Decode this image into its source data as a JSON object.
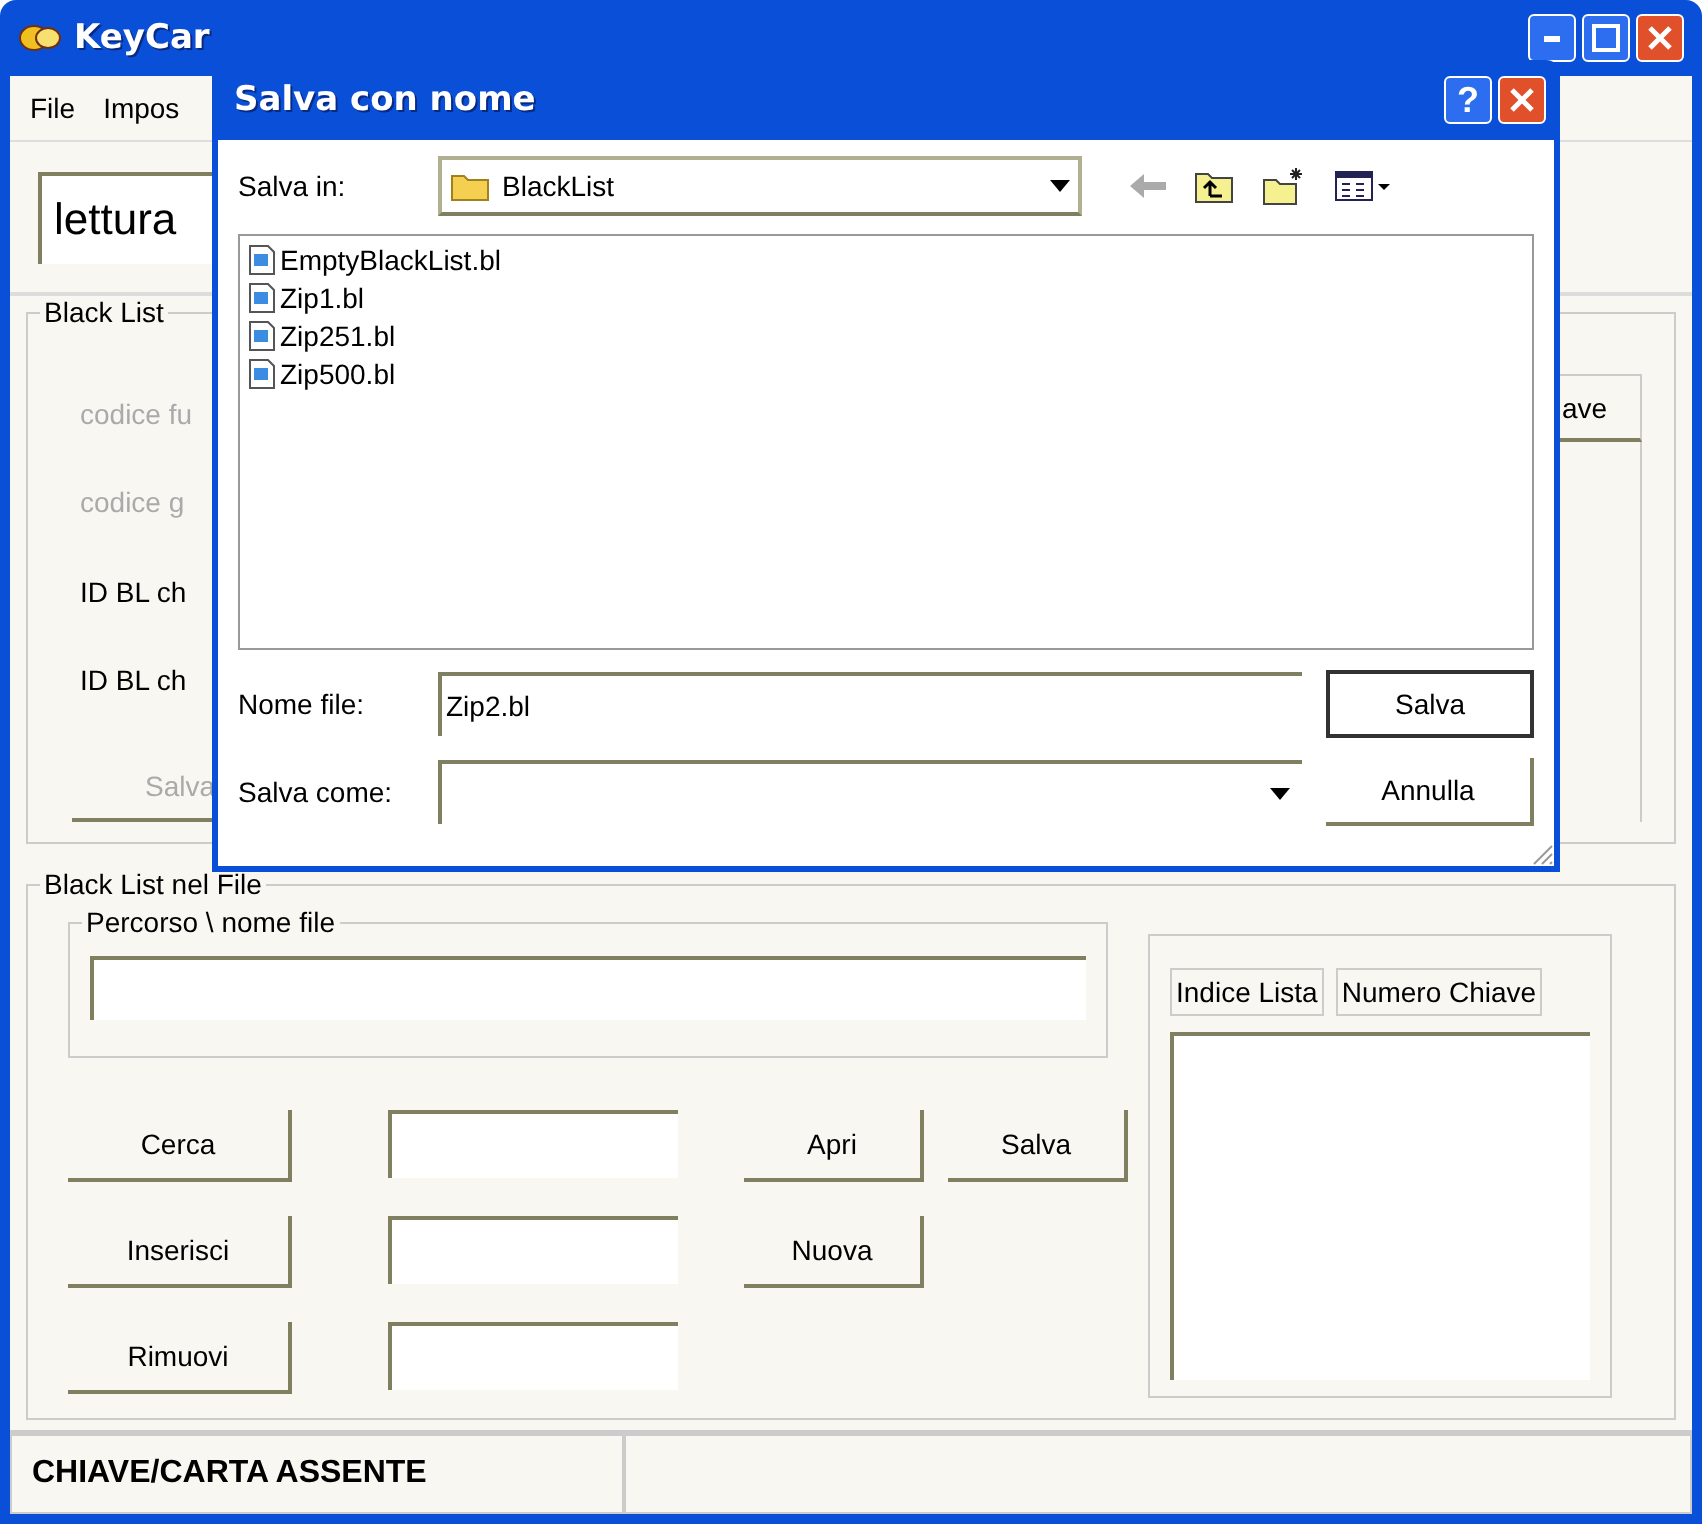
{
  "window": {
    "title": "KeyCar"
  },
  "menu": [
    {
      "label": "File"
    },
    {
      "label": "Impos"
    }
  ],
  "mode_field": {
    "value": "lettura"
  },
  "black_list": {
    "title": "Black List",
    "rows": [
      {
        "label": "codice fu",
        "disabled": true
      },
      {
        "label": "codice g",
        "disabled": true
      },
      {
        "label": "ID BL ch",
        "disabled": false
      },
      {
        "label": "ID BL ch",
        "disabled": false
      }
    ],
    "button": {
      "label": "Salva",
      "disabled": true
    },
    "column_header": "ave"
  },
  "file_section": {
    "title": "Black List nel File",
    "path_title": "Percorso \\ nome file",
    "actions": [
      {
        "label": "Cerca"
      },
      {
        "label": "Inserisci"
      },
      {
        "label": "Rimuovi"
      }
    ],
    "buttons": [
      {
        "label": "Apri"
      },
      {
        "label": "Salva"
      },
      {
        "label": "Nuova"
      }
    ],
    "list_columns": [
      "Indice Lista",
      "Numero Chiave"
    ]
  },
  "status_bar": [
    "CHIAVE/CARTA ASSENTE"
  ],
  "dialog": {
    "title": "Salva con nome",
    "help_button": "?",
    "save_in": {
      "label": "Salva in:",
      "value": "BlackList"
    },
    "files": [
      "EmptyBlackList.bl",
      "Zip1.bl",
      "Zip251.bl",
      "Zip500.bl"
    ],
    "file_name": {
      "label": "Nome file:",
      "value": "Zip2.bl"
    },
    "save_as": {
      "label": "Salva come:"
    },
    "buttons": [
      {
        "label": "Salva",
        "default": true
      },
      {
        "label": "Annulla",
        "default": false
      }
    ]
  }
}
